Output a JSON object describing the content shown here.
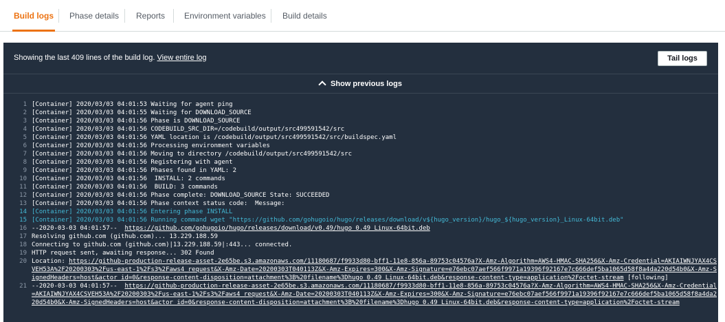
{
  "tabs": [
    {
      "label": "Build logs",
      "active": true
    },
    {
      "label": "Phase details"
    },
    {
      "label": "Reports"
    },
    {
      "label": "Environment variables"
    },
    {
      "label": "Build details"
    }
  ],
  "log_header": {
    "text": "Showing the last 409 lines of the build log.",
    "link": "View entire log",
    "tail_button": "Tail logs",
    "show_previous": "Show previous logs"
  },
  "colors": {
    "accent": "#ec7211",
    "panel_bg": "#232f3e",
    "phase_text": "#44b9d6"
  },
  "lines": [
    {
      "n": "1",
      "text": "[Container] 2020/03/03 04:01:53 Waiting for agent ping"
    },
    {
      "n": "2",
      "text": "[Container] 2020/03/03 04:01:55 Waiting for DOWNLOAD_SOURCE"
    },
    {
      "n": "3",
      "text": "[Container] 2020/03/03 04:01:56 Phase is DOWNLOAD_SOURCE"
    },
    {
      "n": "4",
      "text": "[Container] 2020/03/03 04:01:56 CODEBUILD_SRC_DIR=/codebuild/output/src499591542/src"
    },
    {
      "n": "5",
      "text": "[Container] 2020/03/03 04:01:56 YAML location is /codebuild/output/src499591542/src/buildspec.yaml"
    },
    {
      "n": "6",
      "text": "[Container] 2020/03/03 04:01:56 Processing environment variables"
    },
    {
      "n": "7",
      "text": "[Container] 2020/03/03 04:01:56 Moving to directory /codebuild/output/src499591542/src"
    },
    {
      "n": "8",
      "text": "[Container] 2020/03/03 04:01:56 Registering with agent"
    },
    {
      "n": "9",
      "text": "[Container] 2020/03/03 04:01:56 Phases found in YAML: 2"
    },
    {
      "n": "10",
      "text": "[Container] 2020/03/03 04:01:56  INSTALL: 2 commands"
    },
    {
      "n": "11",
      "text": "[Container] 2020/03/03 04:01:56  BUILD: 3 commands"
    },
    {
      "n": "12",
      "text": "[Container] 2020/03/03 04:01:56 Phase complete: DOWNLOAD_SOURCE State: SUCCEEDED"
    },
    {
      "n": "13",
      "text": "[Container] 2020/03/03 04:01:56 Phase context status code:  Message:"
    },
    {
      "n": "14",
      "text": "[Container] 2020/03/03 04:01:56 Entering phase INSTALL",
      "blue": true
    },
    {
      "n": "15",
      "text": "[Container] 2020/03/03 04:01:56 Running command wget \"https://github.com/gohugoio/hugo/releases/download/v${hugo_version}/hugo_${hugo_version}_Linux-64bit.deb\"",
      "blue": true
    },
    {
      "n": "16",
      "text": "--2020-03-03 04:01:57--  ",
      "link": "https://github.com/gohugoio/hugo/releases/download/v0.49/hugo_0.49_Linux-64bit.deb"
    },
    {
      "n": "17",
      "text": "Resolving github.com (github.com)... 13.229.188.59"
    },
    {
      "n": "18",
      "text": "Connecting to github.com (github.com)|13.229.188.59|:443... connected."
    },
    {
      "n": "19",
      "text": "HTTP request sent, awaiting response... 302 Found"
    },
    {
      "n": "20",
      "text": "Location: ",
      "link": "https://github-production-release-asset-2e65be.s3.amazonaws.com/11180687/f9933d80-bff1-11e8-856a-89753c04576a?X-Amz-Algorithm=AWS4-HMAC-SHA256&X-Amz-Credential=AKIAIWNJYAX4CSVEH53A%2F20200303%2Fus-east-1%2Fs3%2Faws4_request&X-Amz-Date=20200303T040113Z&X-Amz-Expires=300&X-Amz-Signature=e76ebc07aef566f9971a19396f92167e7c666def5ba1065d58f8a4da220d54b0&X-Amz-SignedHeaders=host&actor_id=0&response-content-disposition=attachment%3B%20filename%3Dhugo_0.49_Linux-64bit.deb&response-content-type=application%2Foctet-stream",
      "after": " [following]"
    },
    {
      "n": "21",
      "text": "--2020-03-03 04:01:57--  ",
      "link": "https://github-production-release-asset-2e65be.s3.amazonaws.com/11180687/f9933d80-bff1-11e8-856a-89753c04576a?X-Amz-Algorithm=AWS4-HMAC-SHA256&X-Amz-Credential=AKIAIWNJYAX4CSVEH53A%2F20200303%2Fus-east-1%2Fs3%2Faws4_request&X-Amz-Date=20200303T040113Z&X-Amz-Expires=300&X-Amz-Signature=e76ebc07aef566f9971a19396f92167e7c666def5ba1065d58f8a4da220d54b0&X-Amz-SignedHeaders=host&actor_id=0&response-content-disposition=attachment%3B%20filename%3Dhugo_0.49_Linux-64bit.deb&response-content-type=application%2Foctet-stream"
    }
  ]
}
